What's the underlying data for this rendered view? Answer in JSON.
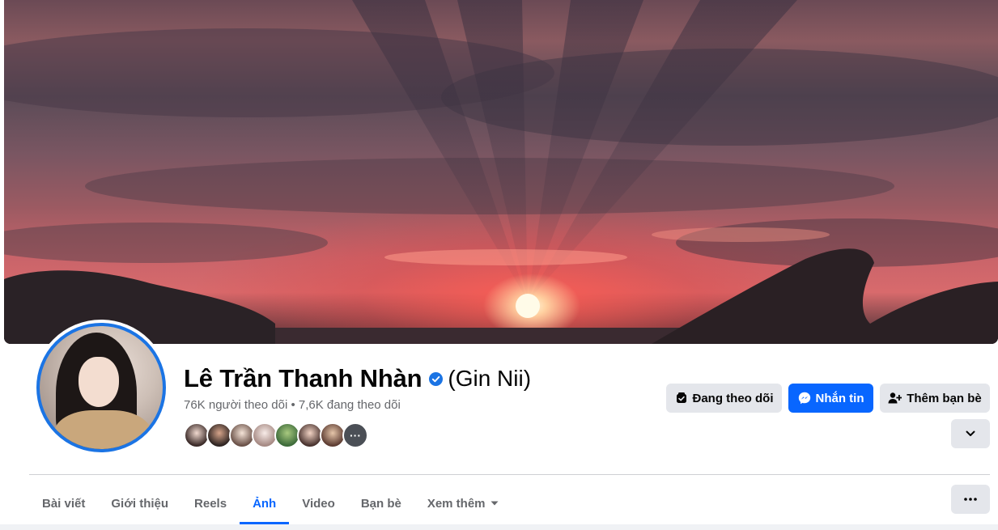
{
  "profile": {
    "name": "Lê Trần Thanh Nhàn",
    "alt_name": "(Gin Nii)",
    "verified": true,
    "follow_stats": "76K người theo dõi • 7,6K đang theo dõi",
    "mutual_more_label": "···"
  },
  "actions": {
    "following_label": "Đang theo dõi",
    "message_label": "Nhắn tin",
    "add_friend_label": "Thêm bạn bè"
  },
  "tabs": [
    {
      "label": "Bài viết",
      "active": false
    },
    {
      "label": "Giới thiệu",
      "active": false
    },
    {
      "label": "Reels",
      "active": false
    },
    {
      "label": "Ảnh",
      "active": true
    },
    {
      "label": "Video",
      "active": false
    },
    {
      "label": "Bạn bè",
      "active": false
    },
    {
      "label": "Xem thêm",
      "active": false
    }
  ],
  "colors": {
    "accent": "#0866ff",
    "verified": "#1b74e4",
    "grey_button": "#e4e6eb",
    "muted_text": "#65676b"
  },
  "icons": [
    "following-icon",
    "messenger-icon",
    "add-friend-icon",
    "chevron-down-icon",
    "more-options-icon",
    "verified-badge-icon",
    "caret-down-icon"
  ]
}
